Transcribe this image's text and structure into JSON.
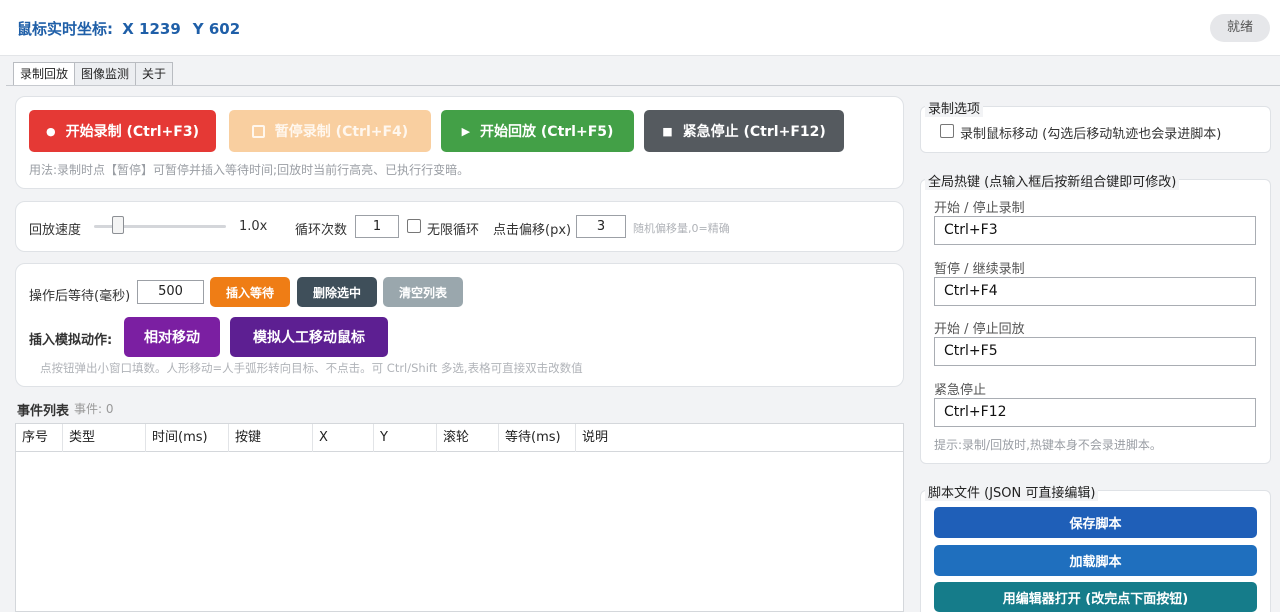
{
  "header": {
    "coord_label": "鼠标实时坐标:",
    "x_text": "X 1239",
    "y_text": "Y 602",
    "status": "就绪"
  },
  "tabs": [
    {
      "label": "录制回放",
      "active": true
    },
    {
      "label": "图像监测",
      "active": false
    },
    {
      "label": "关于",
      "active": false
    }
  ],
  "record_controls": {
    "start_record": "开始录制 (Ctrl+F3)",
    "pause_record": "暂停录制 (Ctrl+F4)",
    "start_playback": "开始回放 (Ctrl+F5)",
    "emergency_stop": "紧急停止 (Ctrl+F12)",
    "usage_hint": "用法:录制时点【暂停】可暂停并插入等待时间;回放时当前行高亮、已执行行变暗。"
  },
  "playback": {
    "speed_label": "回放速度",
    "speed_value": "1.0x",
    "speed_level": 0.1,
    "loop_label": "循环次数",
    "loop_value": "1",
    "infinite_label": "无限循环",
    "offset_label": "点击偏移(px)",
    "offset_value": "3",
    "offset_hint": "随机偏移量,0=精确"
  },
  "actions": {
    "wait_label": "操作后等待(毫秒)",
    "wait_value": "500",
    "insert_wait": "插入等待",
    "delete_selected": "删除选中",
    "clear_list": "清空列表",
    "insert_sim_label": "插入模拟动作:",
    "relative_move": "相对移动",
    "human_move": "模拟人工移动鼠标",
    "hint": "点按钮弹出小窗口填数。人形移动=人手弧形转向目标、不点击。可 Ctrl/Shift 多选,表格可直接双击改数值"
  },
  "events": {
    "title": "事件列表",
    "count": "事件: 0",
    "columns": [
      "序号",
      "类型",
      "时间(ms)",
      "按键",
      "X",
      "Y",
      "滚轮",
      "等待(ms)",
      "说明"
    ]
  },
  "record_options": {
    "title": "录制选项",
    "record_mouse_move": "录制鼠标移动 (勾选后移动轨迹也会录进脚本)"
  },
  "hotkeys": {
    "title": "全局热键 (点输入框后按新组合键即可修改)",
    "items": [
      {
        "label": "开始 / 停止录制",
        "value": "Ctrl+F3"
      },
      {
        "label": "暂停 / 继续录制",
        "value": "Ctrl+F4"
      },
      {
        "label": "开始 / 停止回放",
        "value": "Ctrl+F5"
      },
      {
        "label": "紧急停止",
        "value": "Ctrl+F12"
      }
    ],
    "hint": "提示:录制/回放时,热键本身不会录进脚本。"
  },
  "script_file": {
    "title": "脚本文件 (JSON 可直接编辑)",
    "save": "保存脚本",
    "load": "加载脚本",
    "open_editor": "用编辑器打开 (改完点下面按钮)"
  }
}
